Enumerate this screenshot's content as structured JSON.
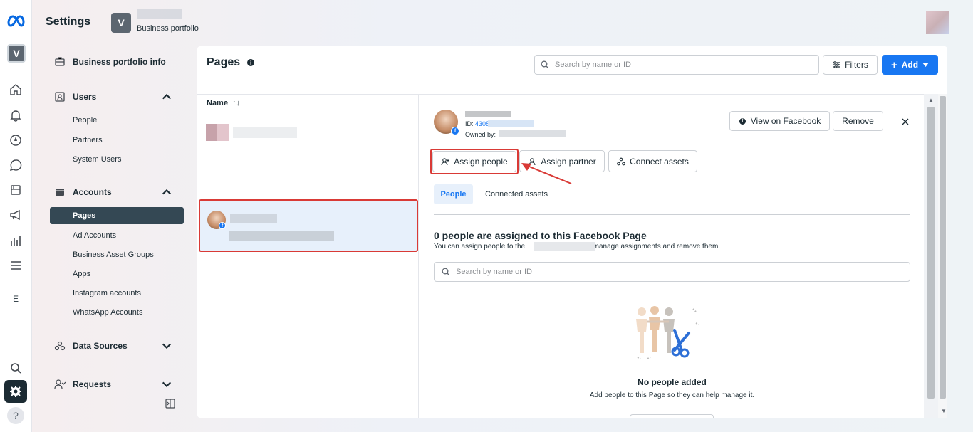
{
  "app": {
    "title": "Settings",
    "portfolio_initial": "V",
    "portfolio_sub": "Business portfolio"
  },
  "rail": {
    "letter": "E",
    "help": "?"
  },
  "nav": {
    "business_info": "Business portfolio info",
    "users": "Users",
    "users_items": [
      "People",
      "Partners",
      "System Users"
    ],
    "accounts": "Accounts",
    "accounts_items": [
      "Pages",
      "Ad Accounts",
      "Business Asset Groups",
      "Apps",
      "Instagram accounts",
      "WhatsApp Accounts"
    ],
    "data_sources": "Data Sources",
    "requests": "Requests"
  },
  "main": {
    "title": "Pages",
    "search_placeholder": "Search by name or ID",
    "filters_label": "Filters",
    "add_label": "Add",
    "column_name": "Name",
    "sort_icon": "↑↓"
  },
  "detail": {
    "id_label": "ID:",
    "id_value": "4308",
    "owned_by": "Owned by:",
    "view_on_facebook": "View on Facebook",
    "remove": "Remove",
    "assign_people": "Assign people",
    "assign_partner": "Assign partner",
    "connect_assets": "Connect assets",
    "tab_people": "People",
    "tab_connected_assets": "Connected assets",
    "heading": "0 people are assigned to this Facebook Page",
    "desc_prefix": "You can assign people to the",
    "desc_suffix": ", manage assignments and remove them.",
    "search_placeholder": "Search by name or ID",
    "empty_title": "No people added",
    "empty_subtitle": "Add people to this Page so they can help manage it."
  },
  "colors": {
    "accent": "#1877f2",
    "nav_active": "#344854",
    "highlight": "#d93a36"
  }
}
